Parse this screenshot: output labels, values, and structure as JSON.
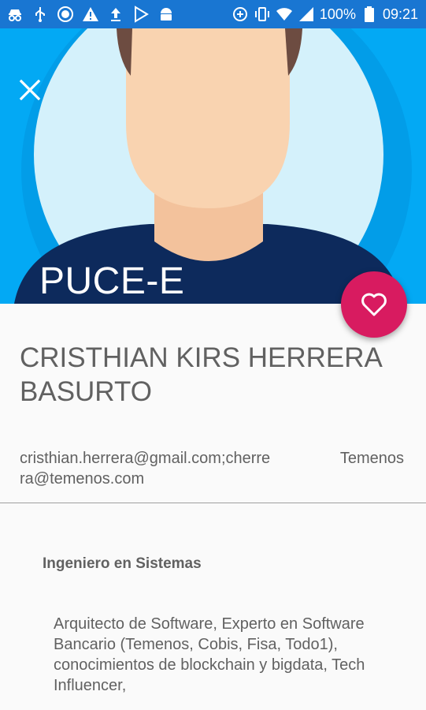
{
  "status_bar": {
    "left_icons": [
      "incognito-icon",
      "usb-icon",
      "target-icon",
      "warning-icon",
      "upload-icon",
      "play-store-icon",
      "android-icon"
    ],
    "right_icons": [
      "data-saver-icon",
      "vibrate-icon",
      "wifi-icon",
      "signal-icon",
      "battery-icon"
    ],
    "battery": "100%",
    "time": "09:21"
  },
  "header": {
    "title": "PUCE-E",
    "close_icon": "close-icon",
    "colors": {
      "background": "#03a9f4",
      "circle": "#d4f1fb",
      "shirt": "#0d2a5c",
      "skin": "#f9d3b0",
      "hair": "#6d4c41"
    }
  },
  "fab": {
    "icon": "heart-outline-icon",
    "color": "#d81b60"
  },
  "profile": {
    "name": "CRISTHIAN KIRS HERRERA BASURTO",
    "email": "cristhian.herrera@gmail.com;cherrera@temenos.com",
    "company": "Temenos",
    "role": "Ingeniero en Sistemas",
    "bio": "Arquitecto de Software, Experto en Software Bancario (Temenos, Cobis, Fisa, Todo1), conocimientos de blockchain y bigdata, Tech Influencer,"
  }
}
